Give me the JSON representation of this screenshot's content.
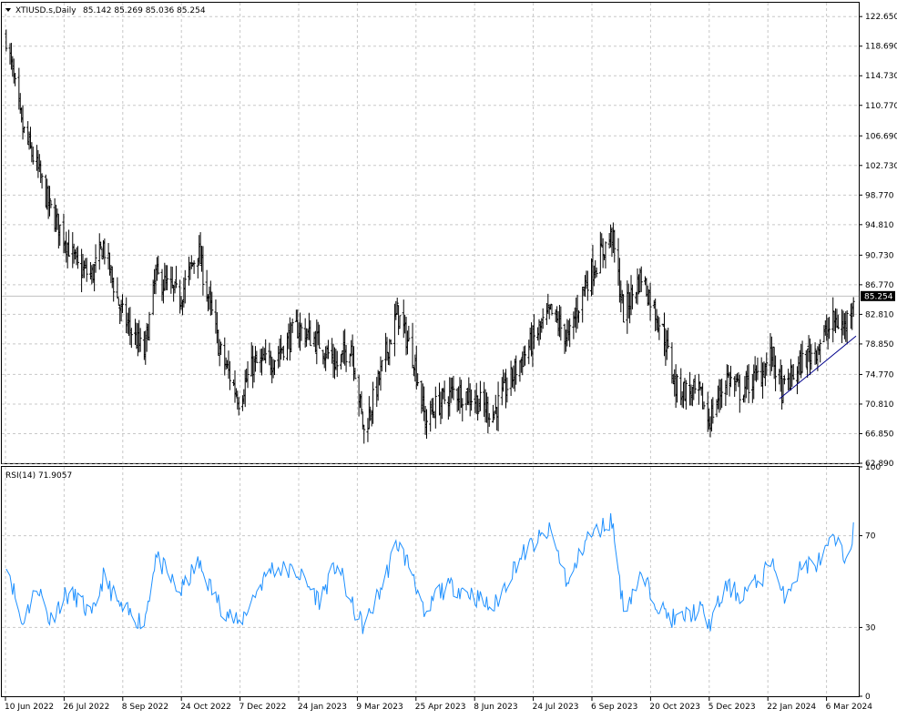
{
  "header": {
    "symbol": "XTIUSD.s,Daily",
    "ohlc": "85.142 85.269 85.036 85.254"
  },
  "price_axis": {
    "ticks": [
      "122.650",
      "118.690",
      "114.730",
      "110.770",
      "106.690",
      "102.730",
      "98.770",
      "94.810",
      "90.730",
      "86.770",
      "82.810",
      "78.850",
      "74.770",
      "70.810",
      "66.850",
      "62.890"
    ],
    "current_price_label": "85.254"
  },
  "rsi_panel": {
    "label": "RSI(14) 71.9057",
    "ticks": [
      "100",
      "70",
      "30",
      "0"
    ]
  },
  "time_axis": {
    "labels": [
      "10 Jun 2022",
      "26 Jul 2022",
      "8 Sep 2022",
      "24 Oct 2022",
      "7 Dec 2022",
      "24 Jan 2023",
      "9 Mar 2023",
      "25 Apr 2023",
      "8 Jun 2023",
      "24 Jul 2023",
      "6 Sep 2023",
      "20 Oct 2023",
      "5 Dec 2023",
      "22 Jan 2024",
      "6 Mar 2024"
    ]
  },
  "colors": {
    "bars": "#000000",
    "rsi_line": "#1e90ff",
    "trendline": "#00008b",
    "grid": "#c8c8c8",
    "current_price_bg": "#000000",
    "current_price_text": "#ffffff"
  },
  "chart_data": [
    {
      "type": "ohlc",
      "timeframe": "Daily",
      "ylim": [
        62.89,
        124.5
      ],
      "grid": true,
      "anchor_points": [
        {
          "date": "2022-06-10",
          "close": 120.0
        },
        {
          "date": "2022-06-22",
          "close": 108.0
        },
        {
          "date": "2022-07-05",
          "close": 102.0
        },
        {
          "date": "2022-07-14",
          "close": 97.0
        },
        {
          "date": "2022-07-26",
          "close": 93.0
        },
        {
          "date": "2022-08-05",
          "close": 89.0
        },
        {
          "date": "2022-08-16",
          "close": 88.0
        },
        {
          "date": "2022-08-25",
          "close": 92.0
        },
        {
          "date": "2022-09-08",
          "close": 83.0
        },
        {
          "date": "2022-09-26",
          "close": 77.5
        },
        {
          "date": "2022-10-05",
          "close": 88.0
        },
        {
          "date": "2022-10-24",
          "close": 85.0
        },
        {
          "date": "2022-11-07",
          "close": 91.5
        },
        {
          "date": "2022-11-24",
          "close": 78.0
        },
        {
          "date": "2022-12-09",
          "close": 71.5
        },
        {
          "date": "2022-12-20",
          "close": 76.0
        },
        {
          "date": "2023-01-03",
          "close": 76.5
        },
        {
          "date": "2023-01-24",
          "close": 81.0
        },
        {
          "date": "2023-02-10",
          "close": 79.0
        },
        {
          "date": "2023-02-24",
          "close": 76.0
        },
        {
          "date": "2023-03-07",
          "close": 79.0
        },
        {
          "date": "2023-03-17",
          "close": 67.0
        },
        {
          "date": "2023-03-31",
          "close": 75.5
        },
        {
          "date": "2023-04-12",
          "close": 83.0
        },
        {
          "date": "2023-04-25",
          "close": 77.0
        },
        {
          "date": "2023-05-04",
          "close": 68.5
        },
        {
          "date": "2023-05-12",
          "close": 70.5
        },
        {
          "date": "2023-05-26",
          "close": 72.5
        },
        {
          "date": "2023-06-08",
          "close": 72.0
        },
        {
          "date": "2023-06-26",
          "close": 69.5
        },
        {
          "date": "2023-07-14",
          "close": 75.5
        },
        {
          "date": "2023-07-24",
          "close": 78.5
        },
        {
          "date": "2023-08-10",
          "close": 83.0
        },
        {
          "date": "2023-08-24",
          "close": 79.5
        },
        {
          "date": "2023-09-06",
          "close": 87.0
        },
        {
          "date": "2023-09-27",
          "close": 93.5
        },
        {
          "date": "2023-10-06",
          "close": 83.0
        },
        {
          "date": "2023-10-20",
          "close": 88.0
        },
        {
          "date": "2023-11-06",
          "close": 80.5
        },
        {
          "date": "2023-11-16",
          "close": 73.0
        },
        {
          "date": "2023-12-05",
          "close": 72.0
        },
        {
          "date": "2023-12-12",
          "close": 68.5
        },
        {
          "date": "2023-12-26",
          "close": 74.5
        },
        {
          "date": "2024-01-05",
          "close": 72.5
        },
        {
          "date": "2024-01-22",
          "close": 75.0
        },
        {
          "date": "2024-01-30",
          "close": 77.5
        },
        {
          "date": "2024-02-07",
          "close": 72.5
        },
        {
          "date": "2024-02-23",
          "close": 76.5
        },
        {
          "date": "2024-03-06",
          "close": 78.5
        },
        {
          "date": "2024-03-19",
          "close": 82.0
        },
        {
          "date": "2024-03-27",
          "close": 81.0
        },
        {
          "date": "2024-04-03",
          "close": 85.254
        }
      ],
      "trendline": [
        {
          "date": "2024-02-05",
          "price": 71.5
        },
        {
          "date": "2024-04-05",
          "price": 79.9
        }
      ],
      "current_price": 85.254
    },
    {
      "type": "line",
      "series": [
        {
          "name": "RSI(14)"
        }
      ],
      "ylim": [
        0,
        100
      ],
      "levels": [
        70,
        30
      ],
      "last_value": 71.9057,
      "points": [
        {
          "date": "2022-06-10",
          "value": 60
        },
        {
          "date": "2022-06-22",
          "value": 32
        },
        {
          "date": "2022-07-05",
          "value": 48
        },
        {
          "date": "2022-07-14",
          "value": 33
        },
        {
          "date": "2022-07-26",
          "value": 44
        },
        {
          "date": "2022-08-05",
          "value": 43
        },
        {
          "date": "2022-08-16",
          "value": 34
        },
        {
          "date": "2022-08-25",
          "value": 52
        },
        {
          "date": "2022-09-08",
          "value": 38
        },
        {
          "date": "2022-09-26",
          "value": 32
        },
        {
          "date": "2022-10-05",
          "value": 61
        },
        {
          "date": "2022-10-24",
          "value": 45
        },
        {
          "date": "2022-11-07",
          "value": 58
        },
        {
          "date": "2022-11-24",
          "value": 40
        },
        {
          "date": "2022-12-09",
          "value": 31
        },
        {
          "date": "2022-12-20",
          "value": 43
        },
        {
          "date": "2023-01-03",
          "value": 56
        },
        {
          "date": "2023-01-24",
          "value": 54
        },
        {
          "date": "2023-02-10",
          "value": 42
        },
        {
          "date": "2023-02-24",
          "value": 58
        },
        {
          "date": "2023-03-07",
          "value": 40
        },
        {
          "date": "2023-03-17",
          "value": 30
        },
        {
          "date": "2023-03-31",
          "value": 48
        },
        {
          "date": "2023-04-12",
          "value": 67
        },
        {
          "date": "2023-04-25",
          "value": 53
        },
        {
          "date": "2023-05-04",
          "value": 32
        },
        {
          "date": "2023-05-12",
          "value": 45
        },
        {
          "date": "2023-05-26",
          "value": 48
        },
        {
          "date": "2023-06-08",
          "value": 45
        },
        {
          "date": "2023-06-26",
          "value": 38
        },
        {
          "date": "2023-07-14",
          "value": 58
        },
        {
          "date": "2023-07-24",
          "value": 65
        },
        {
          "date": "2023-08-10",
          "value": 72
        },
        {
          "date": "2023-08-24",
          "value": 48
        },
        {
          "date": "2023-09-06",
          "value": 68
        },
        {
          "date": "2023-09-27",
          "value": 77
        },
        {
          "date": "2023-10-06",
          "value": 38
        },
        {
          "date": "2023-10-20",
          "value": 52
        },
        {
          "date": "2023-11-06",
          "value": 37
        },
        {
          "date": "2023-11-16",
          "value": 33
        },
        {
          "date": "2023-12-05",
          "value": 38
        },
        {
          "date": "2023-12-12",
          "value": 31
        },
        {
          "date": "2023-12-26",
          "value": 48
        },
        {
          "date": "2024-01-05",
          "value": 44
        },
        {
          "date": "2024-01-22",
          "value": 51
        },
        {
          "date": "2024-01-30",
          "value": 61
        },
        {
          "date": "2024-02-07",
          "value": 43
        },
        {
          "date": "2024-02-23",
          "value": 57
        },
        {
          "date": "2024-03-06",
          "value": 58
        },
        {
          "date": "2024-03-19",
          "value": 68
        },
        {
          "date": "2024-03-27",
          "value": 60
        },
        {
          "date": "2024-04-03",
          "value": 71.9
        }
      ]
    }
  ]
}
